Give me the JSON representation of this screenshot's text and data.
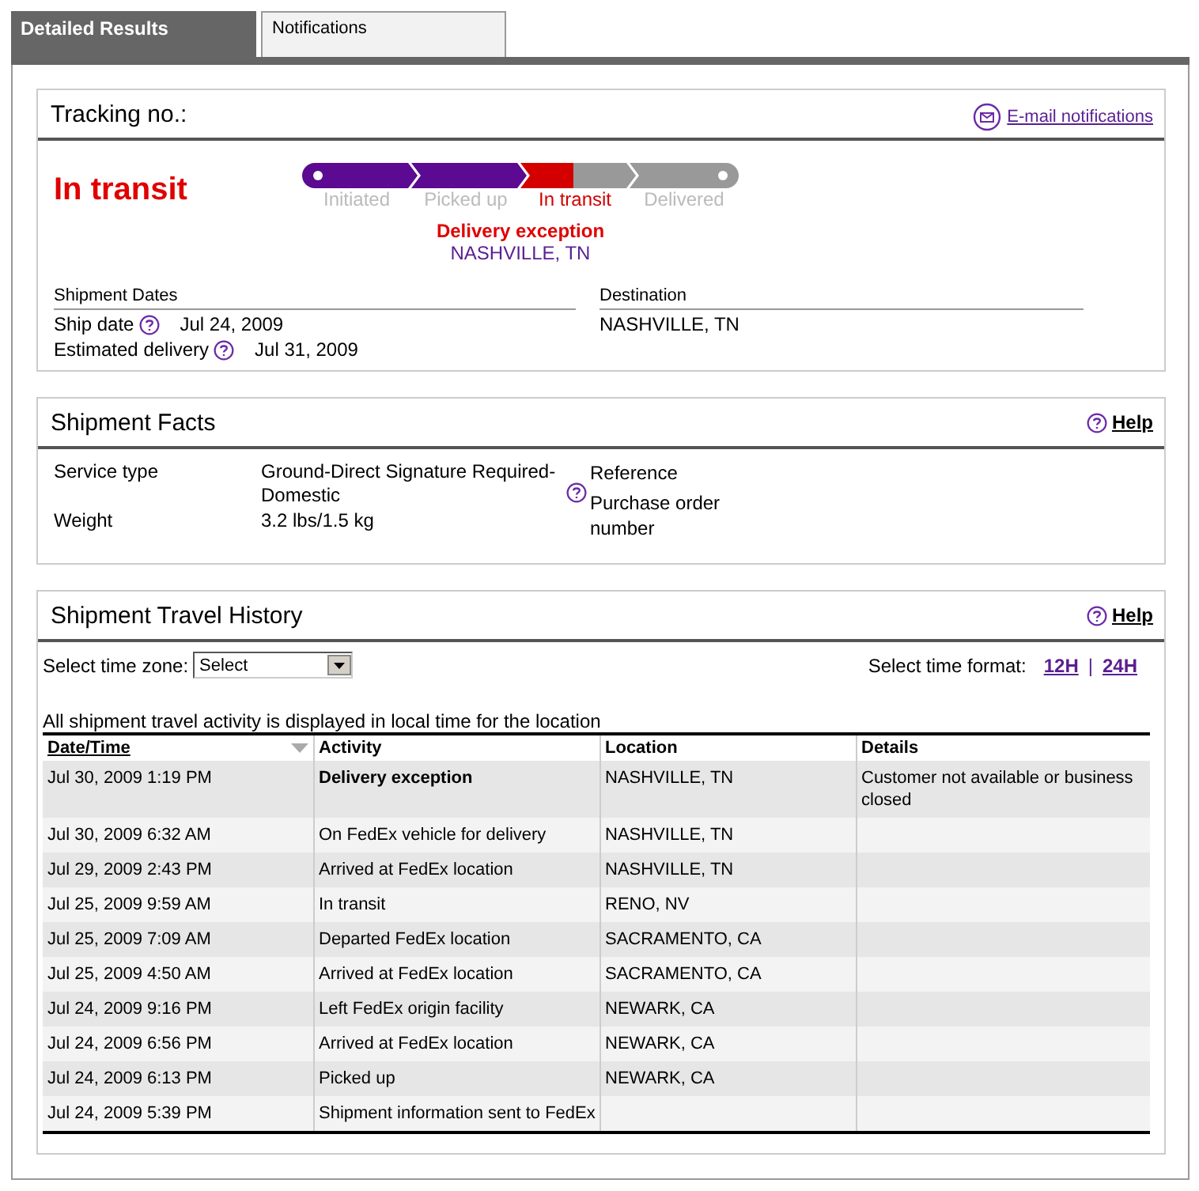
{
  "tabs": [
    {
      "label": "Detailed Results",
      "selected": true
    },
    {
      "label": "Notifications",
      "selected": false
    }
  ],
  "tracking": {
    "title": "Tracking no.:",
    "email_link": "E-mail notifications",
    "status": "In transit",
    "progress": [
      {
        "label": "Initiated",
        "completed": true,
        "current": false
      },
      {
        "label": "Picked up",
        "completed": true,
        "current": false
      },
      {
        "label": "In transit",
        "completed": false,
        "current": true
      },
      {
        "label": "Delivered",
        "completed": false,
        "current": false
      }
    ],
    "exception": "Delivery exception",
    "exception_location": "NASHVILLE, TN",
    "dates": {
      "heading": "Shipment Dates",
      "rows": [
        {
          "label": "Ship date",
          "value": "Jul 24, 2009",
          "help": true
        },
        {
          "label": "Estimated delivery",
          "value": "Jul 31, 2009",
          "help": true
        }
      ]
    },
    "destination": {
      "heading": "Destination",
      "value": "NASHVILLE, TN"
    }
  },
  "facts": {
    "title": "Shipment Facts",
    "help": "Help",
    "rows": [
      {
        "label": "Service type",
        "value": "Ground-Direct Signature Required-Domestic",
        "help": true
      },
      {
        "label": "Weight",
        "value": "3.2 lbs/1.5 kg",
        "help": false
      }
    ],
    "reference": [
      "Reference",
      "Purchase order number"
    ]
  },
  "history": {
    "title": "Shipment Travel History",
    "help": "Help",
    "timezone_label": "Select time zone:",
    "timezone_value": "Select",
    "format_label": "Select time format:",
    "formats": [
      "12H",
      "24H"
    ],
    "format_separator": "|",
    "note": "All shipment travel activity is displayed in local time for the location",
    "columns": [
      {
        "label": "Date/Time",
        "sorted": true
      },
      {
        "label": "Activity",
        "sorted": false
      },
      {
        "label": "Location",
        "sorted": false
      },
      {
        "label": "Details",
        "sorted": false
      }
    ],
    "rows": [
      {
        "date": "Jul 30, 2009 1:19 PM",
        "activity": "Delivery exception",
        "location": "NASHVILLE, TN",
        "details": "Customer not available or business closed",
        "emphasis": true
      },
      {
        "date": "Jul 30, 2009 6:32 AM",
        "activity": "On FedEx vehicle for delivery",
        "location": "NASHVILLE, TN",
        "emphasis": false
      },
      {
        "date": "Jul 29, 2009 2:43 PM",
        "activity": "Arrived at FedEx location",
        "location": "NASHVILLE, TN",
        "emphasis": false
      },
      {
        "date": "Jul 25, 2009 9:59 AM",
        "activity": "In transit",
        "location": "RENO, NV",
        "emphasis": false
      },
      {
        "date": "Jul 25, 2009 7:09 AM",
        "activity": "Departed FedEx location",
        "location": "SACRAMENTO, CA",
        "emphasis": false
      },
      {
        "date": "Jul 25, 2009 4:50 AM",
        "activity": "Arrived at FedEx location",
        "location": "SACRAMENTO, CA",
        "emphasis": false
      },
      {
        "date": "Jul 24, 2009 9:16 PM",
        "activity": "Left FedEx origin facility",
        "location": "NEWARK, CA",
        "emphasis": false
      },
      {
        "date": "Jul 24, 2009 6:56 PM",
        "activity": "Arrived at FedEx location",
        "location": "NEWARK, CA",
        "emphasis": false
      },
      {
        "date": "Jul 24, 2009 6:13 PM",
        "activity": "Picked up",
        "location": "NEWARK, CA",
        "emphasis": false
      },
      {
        "date": "Jul 24, 2009 5:39 PM",
        "activity": "Shipment information sent to FedEx",
        "emphasis": false
      }
    ]
  }
}
